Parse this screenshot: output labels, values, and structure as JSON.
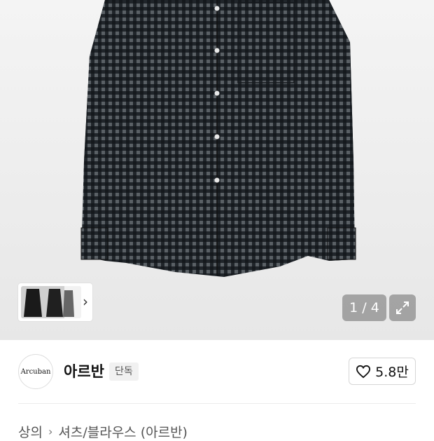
{
  "gallery": {
    "counter": "1 / 4",
    "thumbnail_icon": "product-thumbnail",
    "next_icon": "chevron-right-icon",
    "expand_icon": "expand-icon"
  },
  "brand": {
    "logo_text": "Arcuban",
    "name": "아르반",
    "badge": "단독"
  },
  "like": {
    "icon": "heart-outline-icon",
    "count": "5.8만"
  },
  "breadcrumb": {
    "items": [
      "상의",
      "셔츠/블라우스 (아르반)"
    ]
  },
  "colors": {
    "hero_bg": "#ededed",
    "shirt": "#2b3034",
    "overlay": "#8c8c8c"
  }
}
